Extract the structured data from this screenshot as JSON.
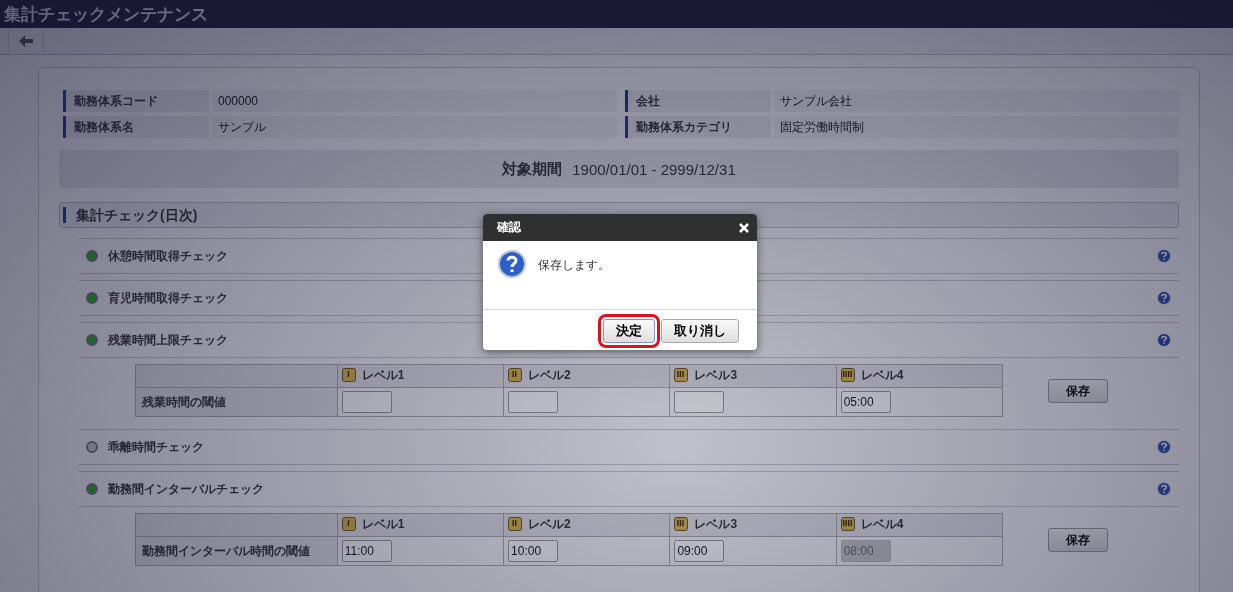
{
  "window": {
    "title": "集計チェックメンテナンス"
  },
  "info": [
    {
      "label": "勤務体系コード",
      "value": "000000"
    },
    {
      "label": "会社",
      "value": "サンプル会社"
    },
    {
      "label": "勤務体系名",
      "value": "サンプル"
    },
    {
      "label": "勤務体系カテゴリ",
      "value": "固定労働時間制"
    }
  ],
  "period": {
    "label": "対象期間",
    "value": "1900/01/01 - 2999/12/31"
  },
  "section": {
    "title": "集計チェック(日次)"
  },
  "checks": [
    {
      "kind": "plain",
      "label": "休憩時間取得チェック",
      "on": true
    },
    {
      "kind": "plain",
      "label": "育児時間取得チェック",
      "on": true
    },
    {
      "kind": "table",
      "label": "残業時間上限チェック",
      "on": true,
      "row_label": "残業時間の閾値",
      "save": "保存",
      "levels": [
        {
          "label": "レベル1",
          "disabled": false
        },
        {
          "label": "レベル2",
          "disabled": false
        },
        {
          "label": "レベル3",
          "disabled": false
        },
        {
          "label": "レベル4",
          "value": "05:00",
          "disabled": false
        }
      ]
    },
    {
      "kind": "plain",
      "label": "乖離時間チェック",
      "on": false
    },
    {
      "kind": "table",
      "label": "勤務間インターバルチェック",
      "on": true,
      "row_label": "勤務間インターバル時間の閾値",
      "save": "保存",
      "levels": [
        {
          "label": "レベル1",
          "value": "11:00",
          "disabled": false
        },
        {
          "label": "レベル2",
          "value": "10:00",
          "disabled": false
        },
        {
          "label": "レベル3",
          "value": "09:00",
          "disabled": false
        },
        {
          "label": "レベル4",
          "value": "08:00",
          "disabled": true
        }
      ]
    }
  ],
  "dialog": {
    "title": "確認",
    "message": "保存します。",
    "buttons": [
      {
        "label": "決定",
        "selected": true
      },
      {
        "label": "取り消し",
        "selected": false
      }
    ]
  }
}
